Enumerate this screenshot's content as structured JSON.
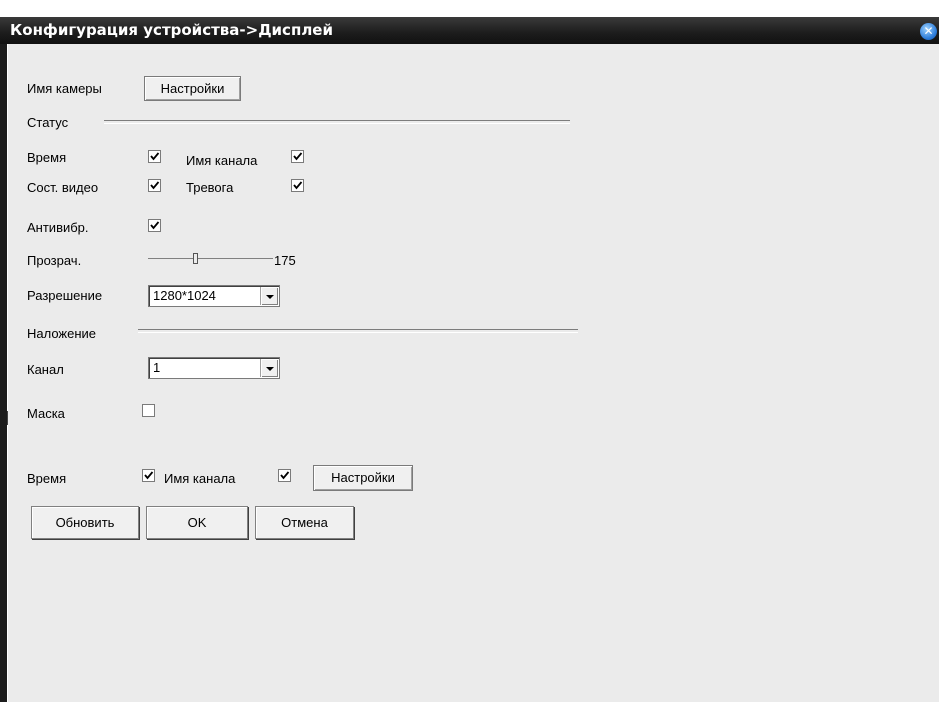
{
  "window": {
    "title": "Конфигурация устройства->Дисплей",
    "close_icon": "close-icon"
  },
  "camera": {
    "name_label": "Имя камеры",
    "settings_button": "Настройки"
  },
  "status": {
    "section_label": "Статус",
    "time_label": "Время",
    "time_checked": true,
    "channel_name_label": "Имя канала",
    "channel_name_checked": true,
    "video_state_label": "Сост. видео",
    "video_state_checked": true,
    "alarm_label": "Тревога",
    "alarm_checked": true,
    "antishake_label": "Антивибр.",
    "antishake_checked": true,
    "transparency_label": "Прозрач.",
    "transparency_value": "175",
    "resolution_label": "Разрешение",
    "resolution_value": "1280*1024"
  },
  "overlay": {
    "section_label": "Наложение",
    "channel_label": "Канал",
    "channel_value": "1",
    "mask_label": "Маска",
    "mask_checked": false,
    "time_label": "Время",
    "time_checked": true,
    "channel_name_label": "Имя канала",
    "channel_name_checked": true,
    "settings_button": "Настройки"
  },
  "actions": {
    "refresh": "Обновить",
    "ok": "OK",
    "cancel": "Отмена"
  }
}
